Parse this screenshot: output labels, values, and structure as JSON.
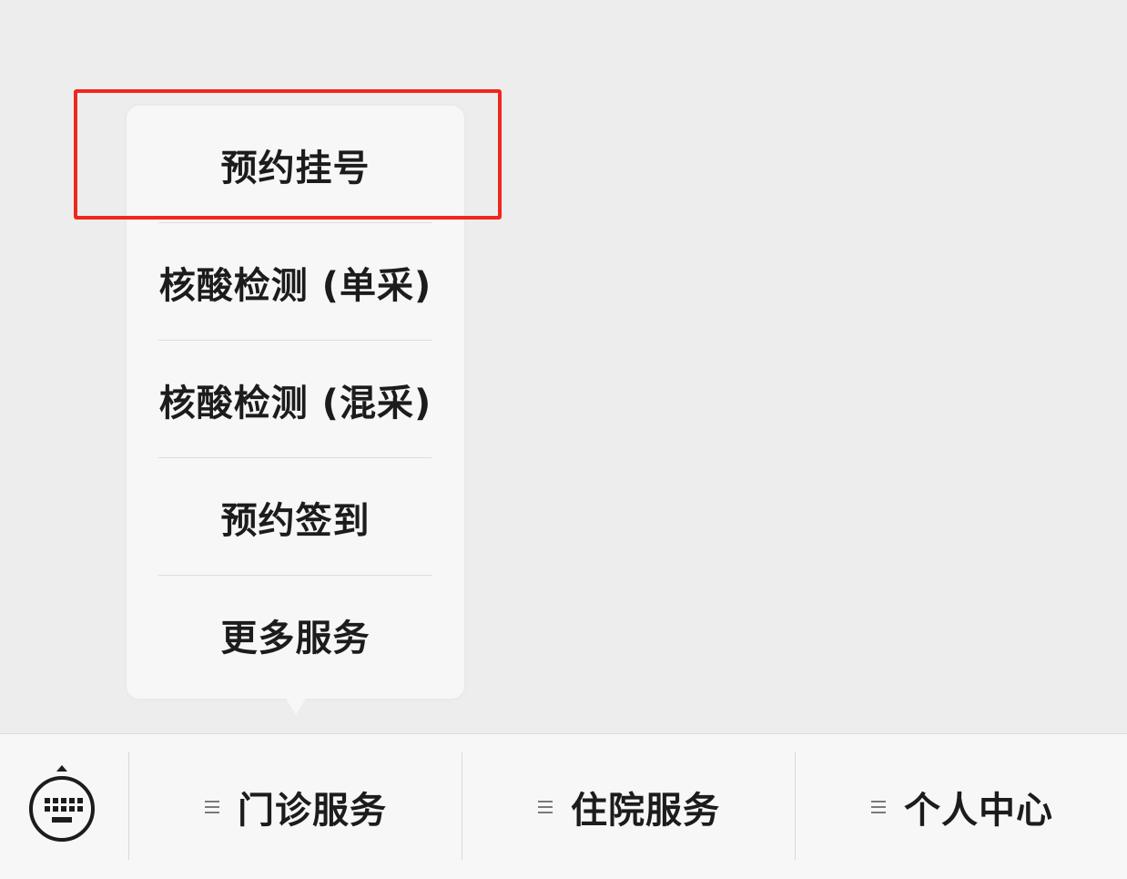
{
  "popup_menu": {
    "items": [
      {
        "label": "预约挂号"
      },
      {
        "label": "核酸检测 (单采)"
      },
      {
        "label": "核酸检测 (混采)"
      },
      {
        "label": "预约签到"
      },
      {
        "label": "更多服务"
      }
    ],
    "highlighted_item": "预约挂号",
    "highlight_color": "#f0271f"
  },
  "bottom_bar": {
    "keyboard_icon": "keyboard-switch-icon",
    "tabs": [
      {
        "label": "门诊服务",
        "icon": "menu-lines-icon"
      },
      {
        "label": "住院服务",
        "icon": "menu-lines-icon"
      },
      {
        "label": "个人中心",
        "icon": "menu-lines-icon"
      }
    ]
  }
}
